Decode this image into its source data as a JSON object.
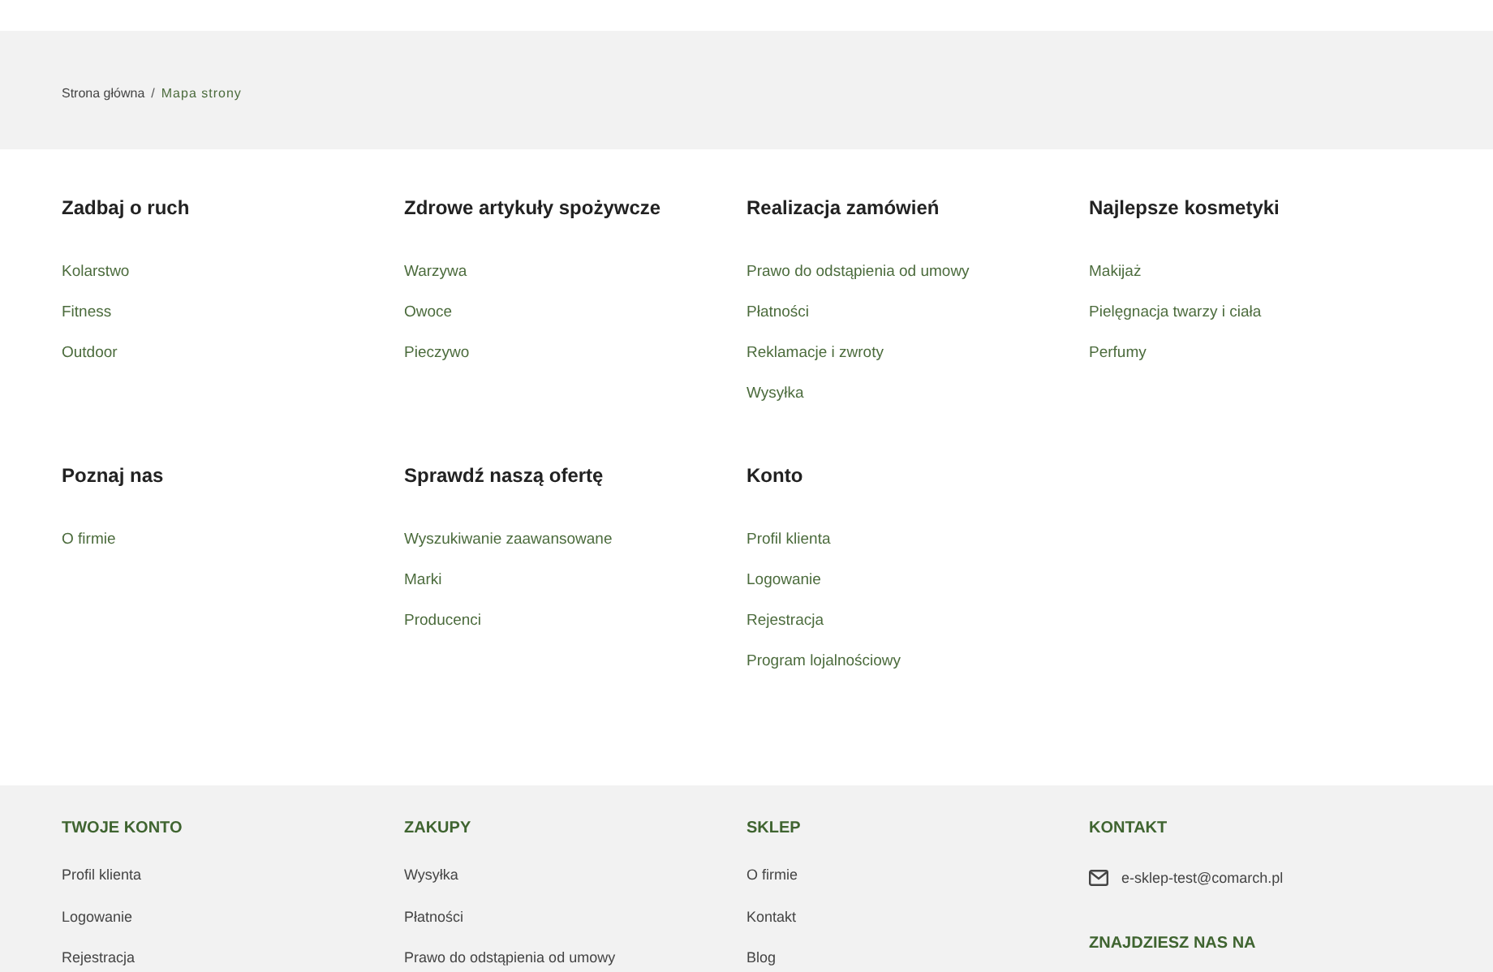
{
  "breadcrumb_separator": "/",
  "breadcrumb": [
    {
      "label": "Strona główna",
      "current": false
    },
    {
      "label": "Mapa strony",
      "current": true
    }
  ],
  "sitemap": {
    "sections": [
      {
        "title": "Zadbaj o ruch",
        "links": [
          "Kolarstwo",
          "Fitness",
          "Outdoor"
        ]
      },
      {
        "title": "Zdrowe artykuły spożywcze",
        "links": [
          "Warzywa",
          "Owoce",
          "Pieczywo"
        ]
      },
      {
        "title": "Realizacja zamówień",
        "links": [
          "Prawo do odstąpienia od umowy",
          "Płatności",
          "Reklamacje i zwroty",
          "Wysyłka"
        ]
      },
      {
        "title": "Najlepsze kosmetyki",
        "links": [
          "Makijaż",
          "Pielęgnacja twarzy i ciała",
          "Perfumy"
        ]
      },
      {
        "title": "Poznaj nas",
        "links": [
          "O firmie"
        ]
      },
      {
        "title": "Sprawdź naszą ofertę",
        "links": [
          "Wyszukiwanie zaawansowane",
          "Marki",
          "Producenci"
        ]
      },
      {
        "title": "Konto",
        "links": [
          "Profil klienta",
          "Logowanie",
          "Rejestracja",
          "Program lojalnościowy"
        ]
      }
    ]
  },
  "footer": {
    "columns": [
      {
        "kind": "links",
        "title": "TWOJE KONTO",
        "links": [
          "Profil klienta",
          "Logowanie",
          "Rejestracja"
        ]
      },
      {
        "kind": "links",
        "title": "ZAKUPY",
        "links": [
          "Wysyłka",
          "Płatności",
          "Prawo do odstąpienia od umowy"
        ]
      },
      {
        "kind": "links",
        "title": "SKLEP",
        "links": [
          "O firmie",
          "Kontakt",
          "Blog"
        ]
      },
      {
        "kind": "contact",
        "title": "KONTAKT",
        "email": "e-sklep-test@comarch.pl",
        "social_title": "ZNAJDZIESZ NAS NA"
      }
    ]
  }
}
